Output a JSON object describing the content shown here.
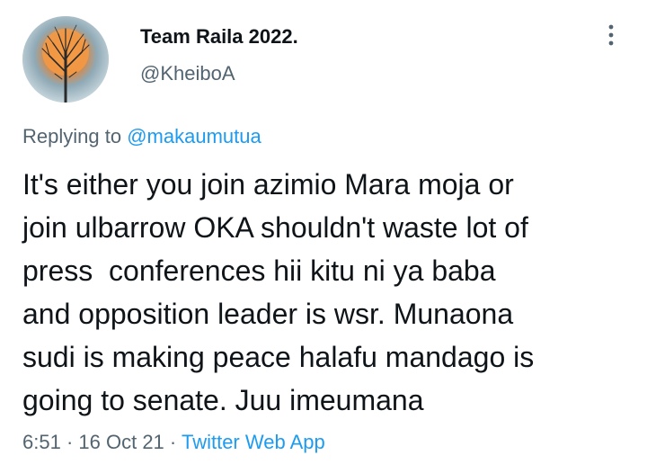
{
  "author": {
    "display_name": "Team Raila 2022.",
    "handle": "@KheiboA",
    "avatar_icon": "tree-at-sunset-avatar"
  },
  "menu": {
    "icon": "more-vertical-icon"
  },
  "reply": {
    "prefix": "Replying to",
    "mention": "@makaumutua"
  },
  "tweet": {
    "lines": [
      "It's either you join azimio Mara moja or",
      "join ulbarrow OKA shouldn't waste lot of",
      "press  conferences hii kitu ni ya baba",
      "and opposition leader is wsr. Munaona",
      "sudi is making peace halafu mandago is",
      "going to senate. Juu imeumana"
    ]
  },
  "meta": {
    "time": "6:51",
    "separator": "·",
    "date": "16 Oct 21",
    "source": "Twitter Web App"
  },
  "colors": {
    "text_primary": "#0f1419",
    "text_secondary": "#536471",
    "link": "#1d9bf0"
  }
}
